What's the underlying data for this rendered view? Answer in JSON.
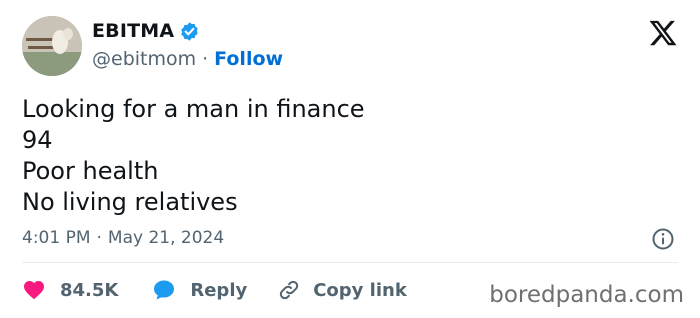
{
  "header": {
    "display_name": "EBITMA",
    "handle": "@ebitmom",
    "separator": "·",
    "follow_label": "Follow"
  },
  "tweet": {
    "lines": [
      "Looking for a man in finance",
      "94",
      "Poor health",
      "No living relatives"
    ],
    "time": "4:01 PM",
    "separator": "·",
    "date": "May 21, 2024"
  },
  "actions": {
    "like_count": "84.5K",
    "reply_label": "Reply",
    "copy_link_label": "Copy link"
  },
  "watermark": "boredpanda.com",
  "icons": {
    "verified": "verified-badge-icon",
    "logo": "x-logo-icon",
    "info": "info-icon",
    "like": "heart-icon",
    "reply": "speech-bubble-icon",
    "copy": "link-icon"
  },
  "colors": {
    "text": "#0f1419",
    "secondary": "#536471",
    "follow": "#006fd6",
    "verified": "#1d9bf0",
    "heart": "#f91880",
    "reply_bubble": "#1d9bf0"
  }
}
